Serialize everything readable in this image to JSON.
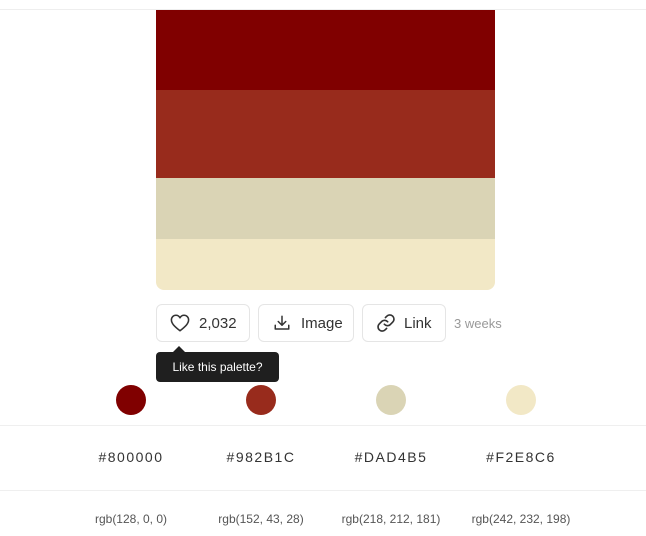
{
  "palette": {
    "colors": [
      "#800000",
      "#982B1C",
      "#DAD4B5",
      "#F2E8C6"
    ]
  },
  "actions": {
    "like_count": "2,032",
    "image_label": "Image",
    "link_label": "Link",
    "time_ago": "3 weeks"
  },
  "tooltip": {
    "text": "Like this palette?"
  },
  "details": [
    {
      "color": "#800000",
      "hex": "#800000",
      "rgb": "rgb(128, 0, 0)"
    },
    {
      "color": "#982B1C",
      "hex": "#982B1C",
      "rgb": "rgb(152, 43, 28)"
    },
    {
      "color": "#DAD4B5",
      "hex": "#DAD4B5",
      "rgb": "rgb(218, 212, 181)"
    },
    {
      "color": "#F2E8C6",
      "hex": "#F2E8C6",
      "rgb": "rgb(242, 232, 198)"
    }
  ]
}
